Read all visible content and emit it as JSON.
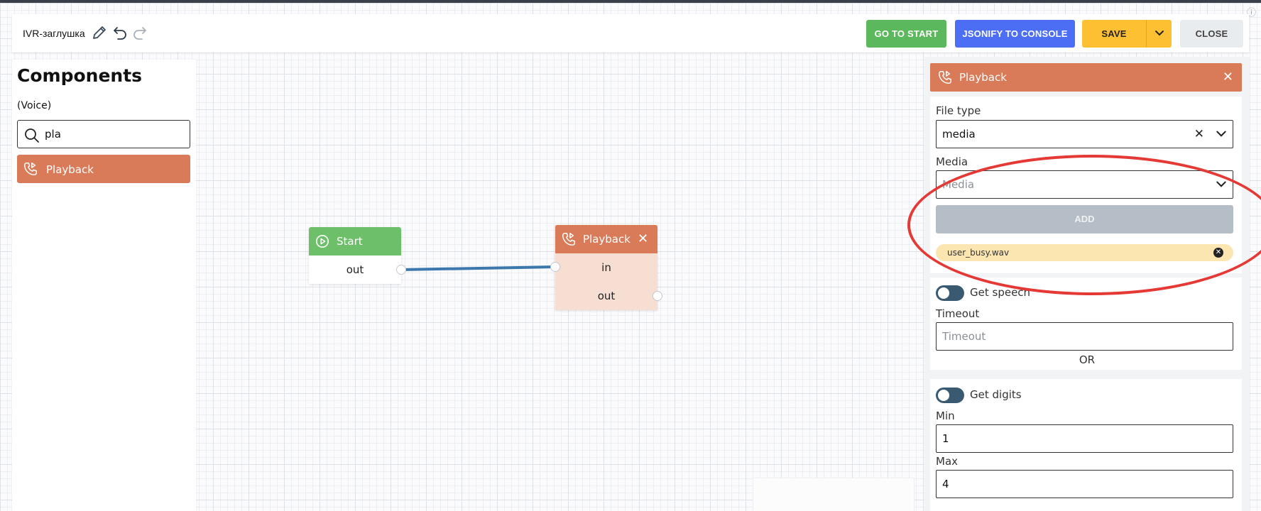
{
  "header": {
    "scheme_name": "IVR-заглушка",
    "buttons": {
      "go_to_start": "GO TO START",
      "jsonify": "JSONIFY TO CONSOLE",
      "save": "SAVE",
      "close": "CLOSE"
    },
    "icons": [
      "pencil-icon",
      "undo-icon",
      "redo-icon",
      "chevron-down-icon"
    ]
  },
  "components": {
    "title": "Components",
    "category": "(Voice)",
    "search": {
      "value": "pla",
      "icon": "search-icon"
    },
    "items": [
      {
        "label": "Playback",
        "icon": "phone-playback-icon"
      }
    ]
  },
  "canvas": {
    "nodes": {
      "start": {
        "title": "Start",
        "ports": [
          "out"
        ],
        "icon": "play-circle-icon"
      },
      "playback": {
        "title": "Playback",
        "ports": [
          "in",
          "out"
        ],
        "icon": "phone-playback-icon"
      }
    }
  },
  "properties": {
    "title": "Playback",
    "file_type": {
      "label": "File type",
      "value": "media"
    },
    "media": {
      "label": "Media",
      "placeholder": "Media"
    },
    "add_label": "ADD",
    "files": [
      "user_busy.wav"
    ],
    "get_speech": {
      "label": "Get speech",
      "enabled": false
    },
    "timeout": {
      "label": "Timeout",
      "placeholder": "Timeout"
    },
    "or_label": "OR",
    "get_digits": {
      "label": "Get digits",
      "enabled": false
    },
    "min": {
      "label": "Min",
      "value": "1"
    },
    "max": {
      "label": "Max",
      "value": "4"
    }
  },
  "colors": {
    "go_to_start": "#5cb85c",
    "jsonify": "#4c6ef5",
    "save": "#fcc032",
    "playback": "#d97b59",
    "start": "#6dbf6a",
    "connection": "#3d78ad",
    "annotation": "#e53935"
  }
}
